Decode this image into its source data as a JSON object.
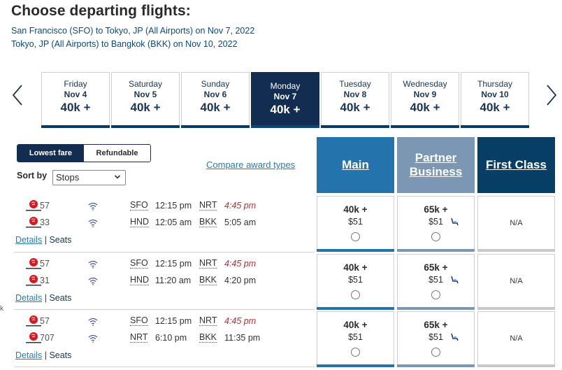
{
  "header": {
    "title": "Choose departing flights:",
    "routes": [
      "San Francisco (SFO) to Tokyo, JP (All Airports) on Nov 7, 2022",
      "Tokyo, JP (All Airports) to Bangkok (BKK) on Nov 10, 2022"
    ]
  },
  "date_nav": {
    "prev_icon": "chevron-left-icon",
    "next_icon": "chevron-right-icon",
    "tabs": [
      {
        "day": "Friday",
        "date": "Nov 4",
        "fare": "40k +",
        "selected": false
      },
      {
        "day": "Saturday",
        "date": "Nov 5",
        "fare": "40k +",
        "selected": false
      },
      {
        "day": "Sunday",
        "date": "Nov 6",
        "fare": "40k +",
        "selected": false
      },
      {
        "day": "Monday",
        "date": "Nov 7",
        "fare": "40k +",
        "selected": true
      },
      {
        "day": "Tuesday",
        "date": "Nov 8",
        "fare": "40k +",
        "selected": false
      },
      {
        "day": "Wednesday",
        "date": "Nov 9",
        "fare": "40k +",
        "selected": false
      },
      {
        "day": "Thursday",
        "date": "Nov 10",
        "fare": "40k +",
        "selected": false
      }
    ]
  },
  "filters": {
    "fare_toggle": {
      "lowest": "Lowest fare",
      "refundable": "Refundable",
      "active": "Lowest fare"
    },
    "sort_label": "Sort by",
    "sort_value": "Stops",
    "compare_link": "Compare award types"
  },
  "cabins": {
    "main": "Main",
    "partner_line1": "Partner",
    "partner_line2": "Business",
    "first": "First Class"
  },
  "colors": {
    "main": "#2573ad",
    "partner": "#7b97b3",
    "first": "#063e66",
    "selected_tab": "#132d52",
    "late_arrival": "#a33a3a",
    "link": "#2a7ab8"
  },
  "results": [
    {
      "segments": [
        {
          "airline": "Japan Airlines",
          "flight": "57",
          "wifi": true,
          "from": "SFO",
          "dep": "12:15 pm",
          "to": "NRT",
          "arr": "4:45 pm",
          "arr_next_day": true
        },
        {
          "airline": "Japan Airlines",
          "flight": "33",
          "wifi": true,
          "from": "HND",
          "dep": "12:05 am",
          "to": "BKK",
          "arr": "5:05 am",
          "arr_next_day": false
        }
      ],
      "details": "Details",
      "sep": "|",
      "seats": "Seats",
      "main": {
        "miles": "40k +",
        "tax": "$51"
      },
      "partner": {
        "miles": "65k +",
        "tax": "$51",
        "icon": "lie-flat-seat-icon"
      },
      "first": {
        "text": "N/A"
      }
    },
    {
      "segments": [
        {
          "airline": "Japan Airlines",
          "flight": "57",
          "wifi": true,
          "from": "SFO",
          "dep": "12:15 pm",
          "to": "NRT",
          "arr": "4:45 pm",
          "arr_next_day": true
        },
        {
          "airline": "Japan Airlines",
          "flight": "31",
          "wifi": true,
          "from": "HND",
          "dep": "11:20 am",
          "to": "BKK",
          "arr": "4:20 pm",
          "arr_next_day": false
        }
      ],
      "details": "Details",
      "sep": "|",
      "seats": "Seats",
      "main": {
        "miles": "40k +",
        "tax": "$51"
      },
      "partner": {
        "miles": "65k +",
        "tax": "$51",
        "icon": "lie-flat-seat-icon"
      },
      "first": {
        "text": "N/A"
      }
    },
    {
      "segments": [
        {
          "airline": "Japan Airlines",
          "flight": "57",
          "wifi": true,
          "from": "SFO",
          "dep": "12:15 pm",
          "to": "NRT",
          "arr": "4:45 pm",
          "arr_next_day": true
        },
        {
          "airline": "Japan Airlines",
          "flight": "707",
          "wifi": true,
          "from": "NRT",
          "dep": "6:10 pm",
          "to": "BKK",
          "arr": "11:35 pm",
          "arr_next_day": false
        }
      ],
      "details": "Details",
      "sep": "|",
      "seats": "Seats",
      "main": {
        "miles": "40k +",
        "tax": "$51"
      },
      "partner": {
        "miles": "65k +",
        "tax": "$51",
        "icon": "lie-flat-seat-icon"
      },
      "first": {
        "text": "N/A"
      }
    }
  ],
  "left_stub": "k"
}
